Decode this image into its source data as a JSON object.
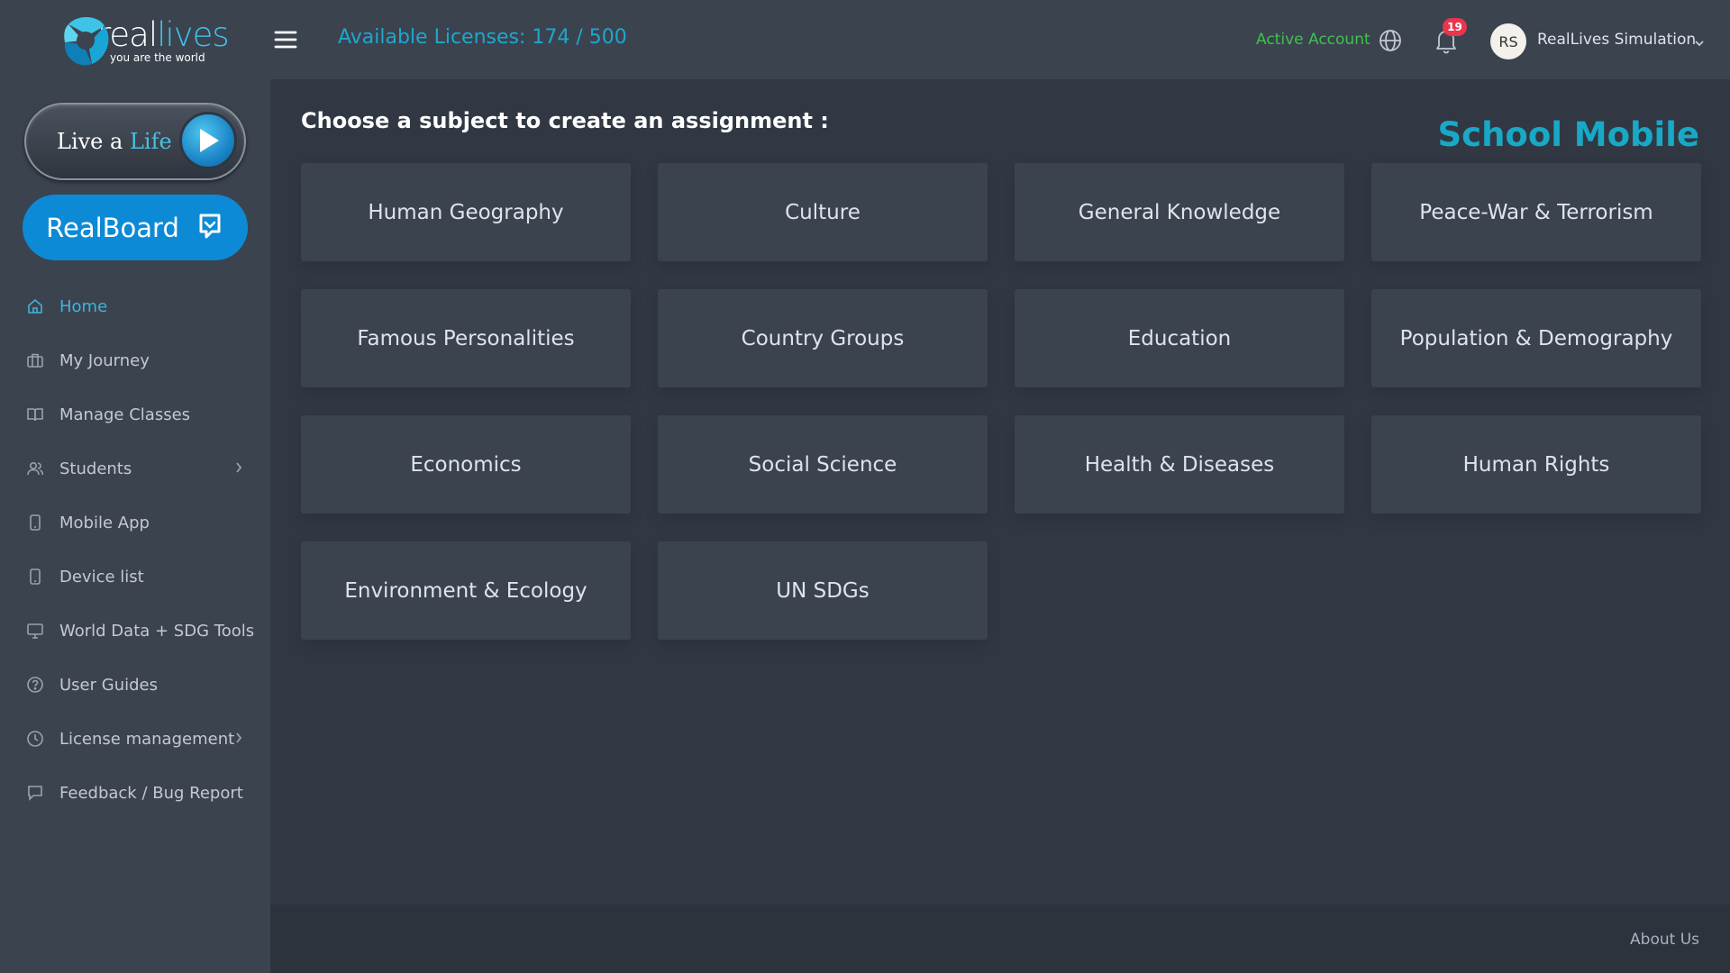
{
  "brand": {
    "logo_word_a": "real",
    "logo_word_b": "lives",
    "tagline": "you are the world",
    "accent_color": "#1ea7cf"
  },
  "sidebar": {
    "live_life": {
      "part1": "Live a ",
      "part2": "Life"
    },
    "realboard_label": "RealBoard",
    "items": [
      {
        "label": "Home",
        "icon": "home-icon",
        "active": true
      },
      {
        "label": "My Journey",
        "icon": "briefcase-icon"
      },
      {
        "label": "Manage Classes",
        "icon": "book-icon"
      },
      {
        "label": "Students",
        "icon": "users-icon",
        "has_submenu": true
      },
      {
        "label": "Mobile App",
        "icon": "phone-icon"
      },
      {
        "label": "Device list",
        "icon": "phone-icon"
      },
      {
        "label": "World Data + SDG Tools",
        "icon": "monitor-icon"
      },
      {
        "label": "User Guides",
        "icon": "help-circle-icon"
      },
      {
        "label": "License management",
        "icon": "clock-icon",
        "has_submenu": true
      },
      {
        "label": "Feedback / Bug Report",
        "icon": "message-icon"
      }
    ]
  },
  "header": {
    "licenses": "Available Licenses: 174 / 500",
    "account_status": "Active Account",
    "notification_count": "19",
    "avatar_initials": "RS",
    "user_name": "RealLives Simulation"
  },
  "main": {
    "title": "Choose a subject to create an assignment :",
    "product": "School Mobile",
    "subjects": [
      "Human Geography",
      "Culture",
      "General Knowledge",
      "Peace-War & Terrorism",
      "Famous Personalities",
      "Country Groups",
      "Education",
      "Population & Demography",
      "Economics",
      "Social Science",
      "Health & Diseases",
      "Human Rights",
      "Environment & Ecology",
      "UN SDGs"
    ]
  },
  "footer": {
    "about": "About Us"
  }
}
